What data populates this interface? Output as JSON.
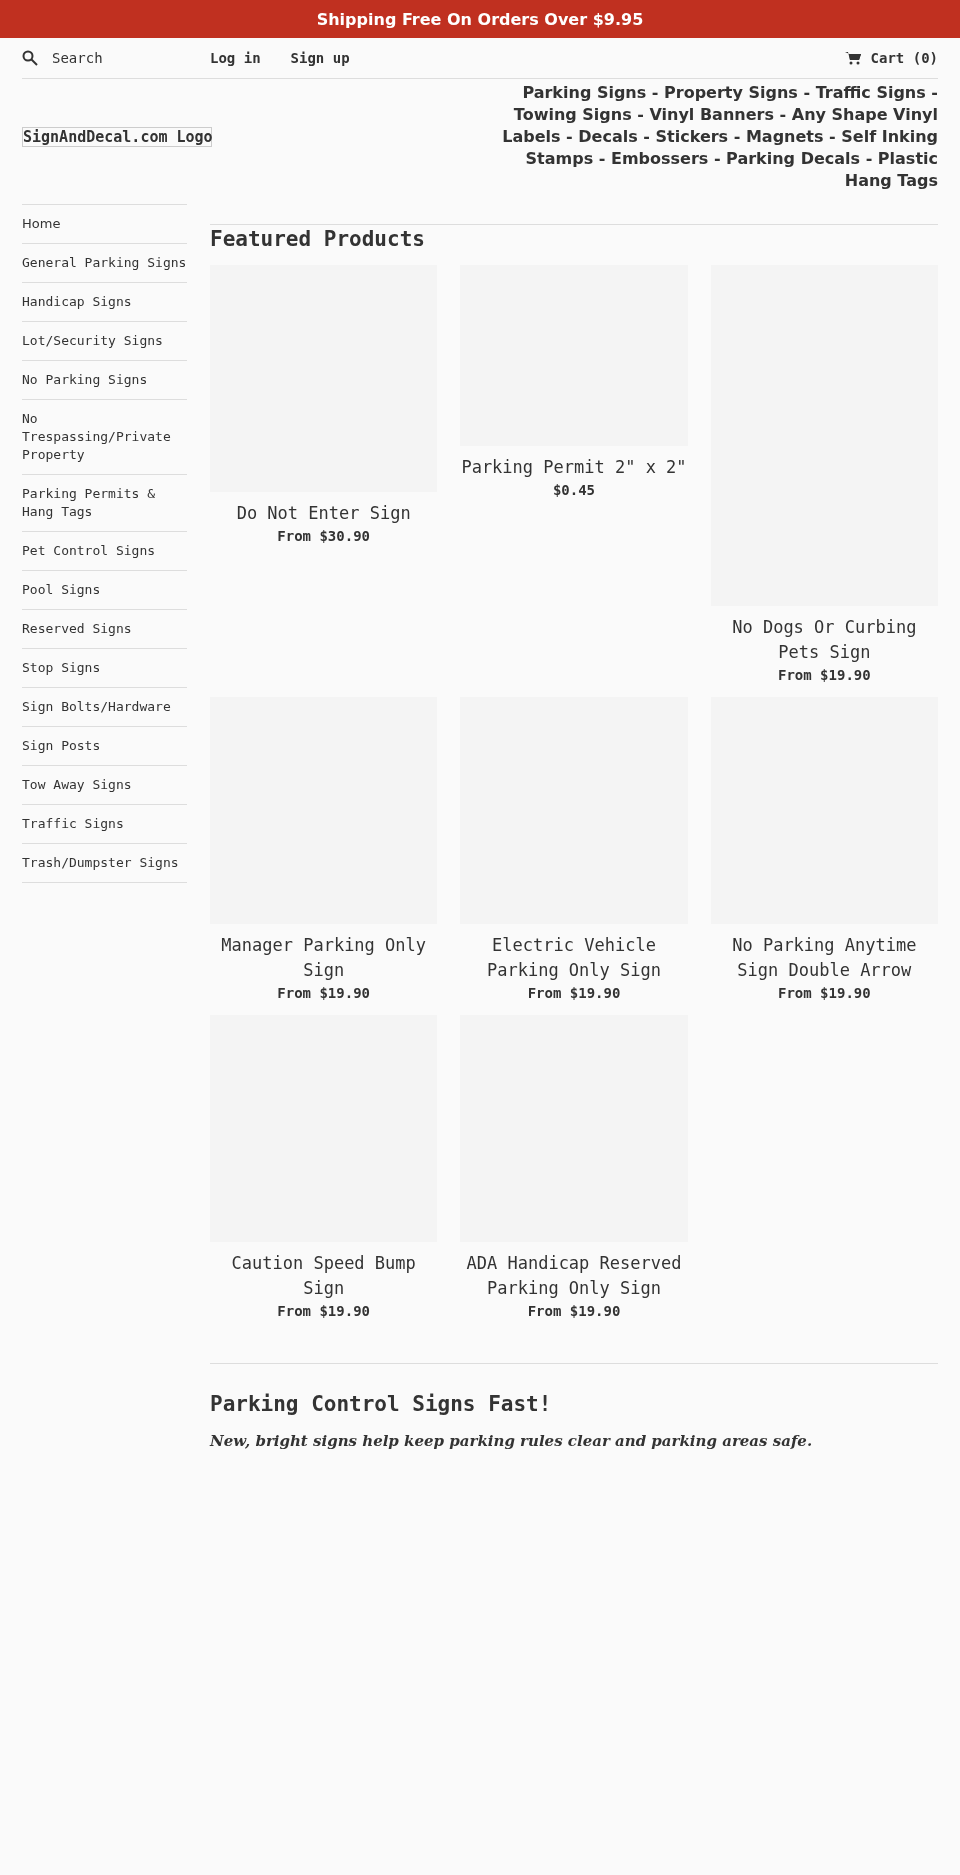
{
  "announcement": "Shipping Free On Orders Over $9.95",
  "header": {
    "search": {
      "placeholder": "Search"
    },
    "links": [
      "Log in",
      "Sign up"
    ],
    "cart": "Cart (0)"
  },
  "logo": "SignAndDecal.com Logo",
  "tagline": "Parking Signs - Property Signs - Traffic Signs - Towing Signs - Vinyl Banners - Any Shape Vinyl Labels - Decals - Stickers - Magnets - Self Inking Stamps - Embossers - Parking Decals - Plastic Hang Tags",
  "sidebar": {
    "items": [
      "Home",
      "General Parking Signs",
      "Handicap Signs",
      "Lot/Security Signs",
      "No Parking Signs",
      "No Trespassing/Private Property",
      "Parking Permits & Hang Tags",
      "Pet Control Signs",
      "Pool Signs",
      "Reserved Signs",
      "Stop Signs",
      "Sign Bolts/Hardware",
      "Sign Posts",
      "Tow Away Signs",
      "Traffic Signs",
      "Trash/Dumpster Signs"
    ]
  },
  "featured": {
    "title": "Featured Products",
    "products": [
      {
        "title": "Do Not Enter Sign",
        "price": "From $30.90"
      },
      {
        "title": "Parking Permit 2\" x 2\"",
        "price": "$0.45"
      },
      {
        "title": "No Dogs Or Curbing Pets Sign",
        "price": "From $19.90"
      },
      {
        "title": "Manager Parking Only Sign",
        "price": "From $19.90"
      },
      {
        "title": "Electric Vehicle Parking Only Sign",
        "price": "From $19.90"
      },
      {
        "title": "No Parking Anytime Sign Double Arrow",
        "price": "From $19.90"
      },
      {
        "title": "Caution Speed Bump Sign",
        "price": "From $19.90"
      },
      {
        "title": "ADA Handicap Reserved Parking Only Sign",
        "price": "From $19.90"
      }
    ]
  },
  "intro": {
    "title": "Parking Control Signs Fast!",
    "text": "New, bright signs help keep parking rules clear and parking areas safe."
  }
}
